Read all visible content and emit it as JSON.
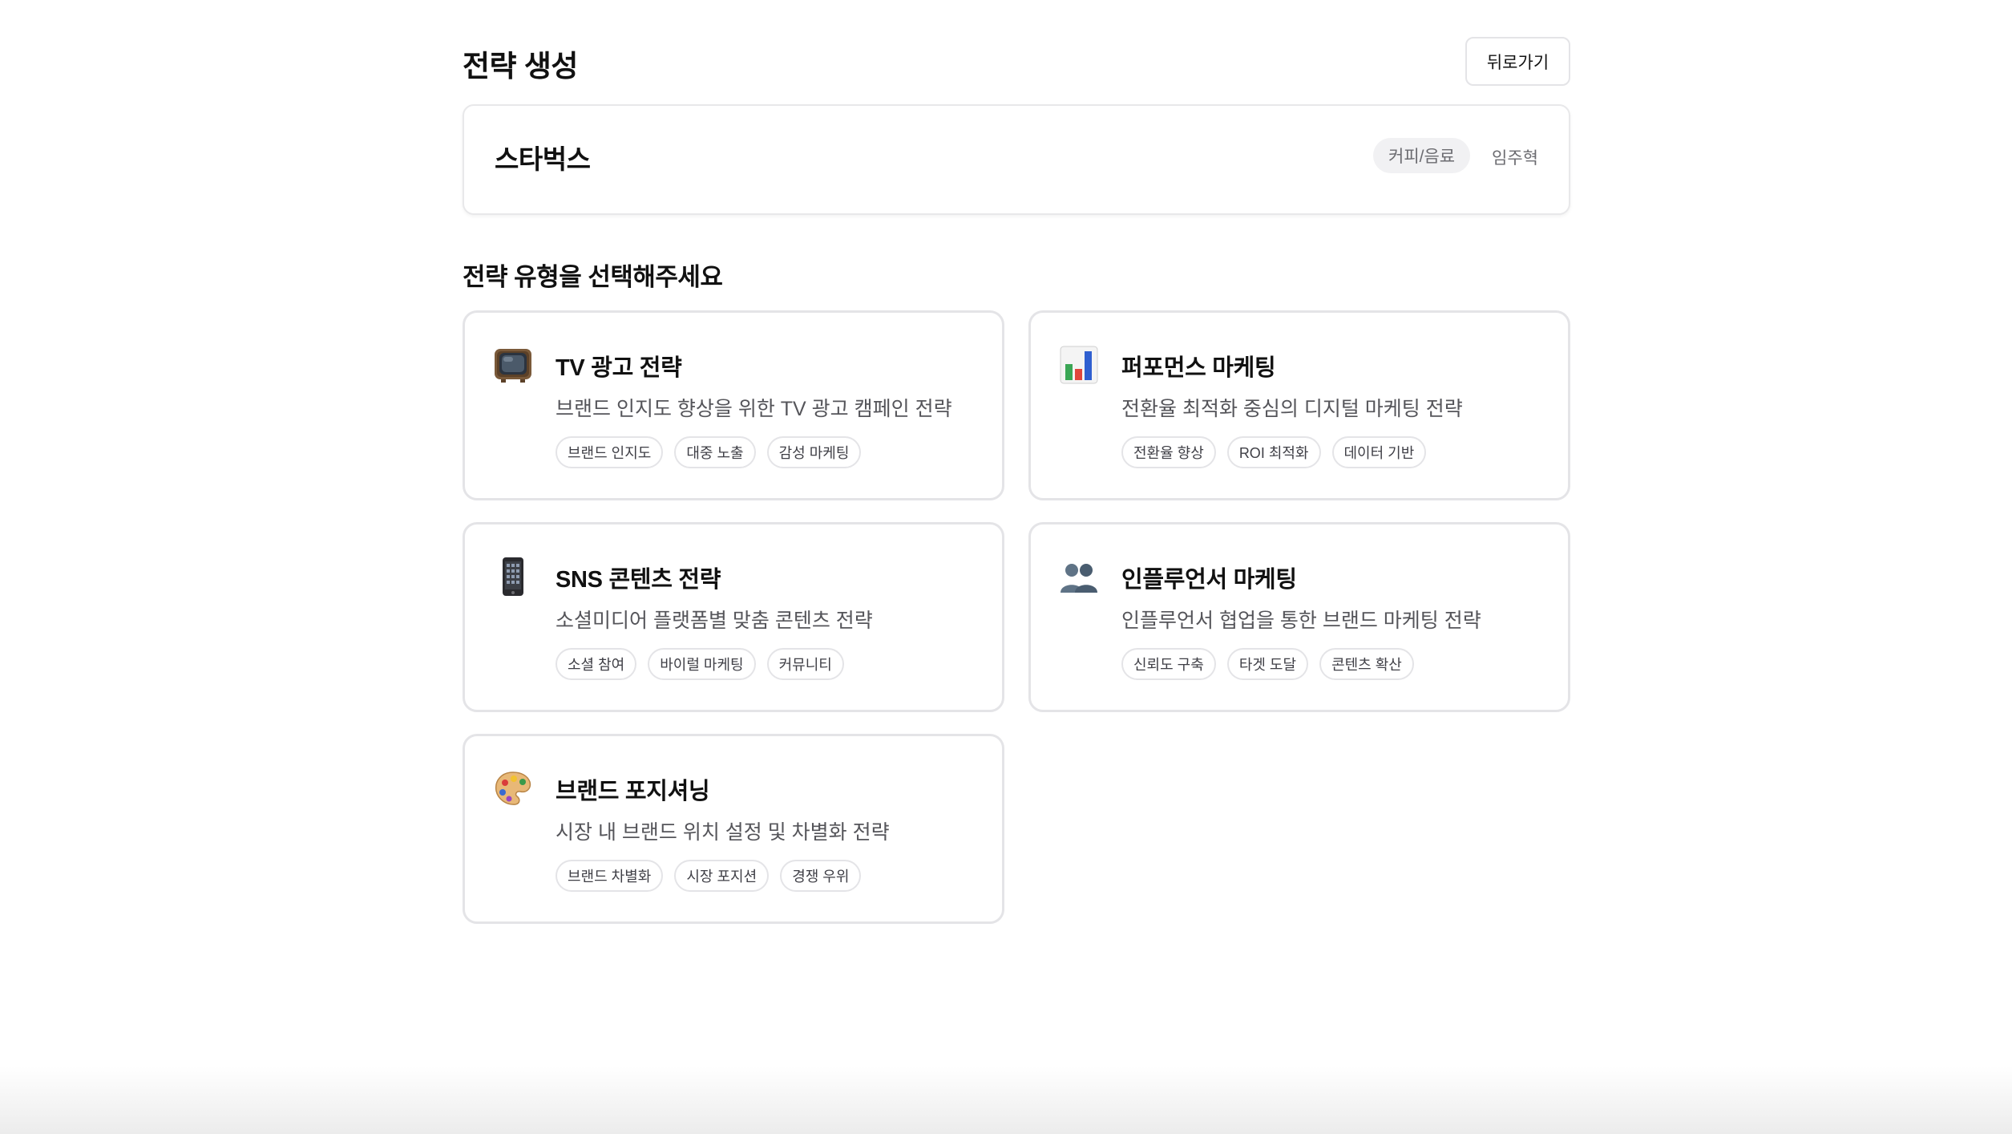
{
  "header": {
    "title": "전략 생성",
    "back_label": "뒤로가기"
  },
  "brand": {
    "name": "스타벅스",
    "category": "커피/음료",
    "owner": "임주혁"
  },
  "section": {
    "title": "전략 유형을 선택해주세요"
  },
  "strategies": [
    {
      "icon": "tv-icon",
      "title": "TV 광고 전략",
      "description": "브랜드 인지도 향상을 위한 TV 광고 캠페인 전략",
      "tags": [
        "브랜드 인지도",
        "대중 노출",
        "감성 마케팅"
      ]
    },
    {
      "icon": "bar-chart-icon",
      "title": "퍼포먼스 마케팅",
      "description": "전환율 최적화 중심의 디지털 마케팅 전략",
      "tags": [
        "전환율 향상",
        "ROI 최적화",
        "데이터 기반"
      ]
    },
    {
      "icon": "mobile-phone-icon",
      "title": "SNS 콘텐츠 전략",
      "description": "소셜미디어 플랫폼별 맞춤 콘텐츠 전략",
      "tags": [
        "소셜 참여",
        "바이럴 마케팅",
        "커뮤니티"
      ]
    },
    {
      "icon": "people-icon",
      "title": "인플루언서 마케팅",
      "description": "인플루언서 협업을 통한 브랜드 마케팅 전략",
      "tags": [
        "신뢰도 구축",
        "타겟 도달",
        "콘텐츠 확산"
      ]
    },
    {
      "icon": "palette-icon",
      "title": "브랜드 포지셔닝",
      "description": "시장 내 브랜드 위치 설정 및 차별화 전략",
      "tags": [
        "브랜드 차별화",
        "시장 포지션",
        "경쟁 우위"
      ]
    }
  ]
}
